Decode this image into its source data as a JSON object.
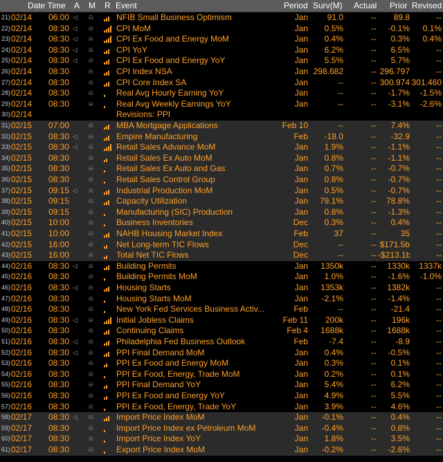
{
  "header": {
    "date_time": "Date Time",
    "a": "A",
    "m": "M",
    "r": "R",
    "event": "Event",
    "period": "Period",
    "surv": "Surv(M)",
    "actual": "Actual",
    "prior": "Prior",
    "revised": "Revised"
  },
  "rows": [
    {
      "num": "21)",
      "date": "02/14",
      "time": "06:00",
      "alarm": true,
      "rel": 3,
      "event": "NFIB Small Business Optimism",
      "period": "Jan",
      "surv": "91.0",
      "actual": "--",
      "prior": "89.8",
      "revised": "--",
      "day": 1
    },
    {
      "num": "22)",
      "date": "02/14",
      "time": "08:30",
      "alarm": true,
      "rel": 4,
      "event": "CPI MoM",
      "period": "Jan",
      "surv": "0.5%",
      "actual": "--",
      "prior": "-0.1%",
      "revised": "0.1%",
      "day": 1
    },
    {
      "num": "23)",
      "date": "02/14",
      "time": "08:30",
      "alarm": true,
      "rel": 4,
      "event": "CPI Ex Food and Energy MoM",
      "period": "Jan",
      "surv": "0.4%",
      "actual": "--",
      "prior": "0.3%",
      "revised": "0.4%",
      "day": 1
    },
    {
      "num": "24)",
      "date": "02/14",
      "time": "08:30",
      "alarm": true,
      "rel": 3,
      "event": "CPI YoY",
      "period": "Jan",
      "surv": "6.2%",
      "actual": "--",
      "prior": "6.5%",
      "revised": "--",
      "day": 1
    },
    {
      "num": "25)",
      "date": "02/14",
      "time": "08:30",
      "alarm": true,
      "rel": 3,
      "event": "CPI Ex Food and Energy YoY",
      "period": "Jan",
      "surv": "5.5%",
      "actual": "--",
      "prior": "5.7%",
      "revised": "--",
      "day": 1
    },
    {
      "num": "26)",
      "date": "02/14",
      "time": "08:30",
      "alarm": false,
      "rel": 3,
      "event": "CPI Index NSA",
      "period": "Jan",
      "surv": "298.682",
      "actual": "--",
      "prior": "296.797",
      "revised": "--",
      "day": 1
    },
    {
      "num": "27)",
      "date": "02/14",
      "time": "08:30",
      "alarm": false,
      "rel": 3,
      "event": "CPI Core Index SA",
      "period": "Jan",
      "surv": "--",
      "actual": "--",
      "prior": "300.974",
      "revised": "301.460",
      "day": 1
    },
    {
      "num": "28)",
      "date": "02/14",
      "time": "08:30",
      "alarm": false,
      "rel": 1,
      "event": "Real Avg Hourly Earning YoY",
      "period": "Jan",
      "surv": "--",
      "actual": "--",
      "prior": "-1.7%",
      "revised": "-1.5%",
      "day": 1
    },
    {
      "num": "29)",
      "date": "02/14",
      "time": "08:30",
      "alarm": false,
      "rel": 1,
      "event": "Real Avg Weekly Earnings YoY",
      "period": "Jan",
      "surv": "--",
      "actual": "--",
      "prior": "-3.1%",
      "revised": "-2.6%",
      "day": 1
    },
    {
      "num": "30)",
      "date": "02/14",
      "time": "",
      "alarm": false,
      "bell": false,
      "rel": 0,
      "event": "Revisions: PPI",
      "period": "",
      "surv": "",
      "actual": "",
      "prior": "",
      "revised": "",
      "day": 1,
      "rev": true
    },
    {
      "num": "31)",
      "date": "02/15",
      "time": "07:00",
      "alarm": false,
      "rel": 3,
      "event": "MBA Mortgage Applications",
      "period": "Feb 10",
      "surv": "--",
      "actual": "--",
      "prior": "7.4%",
      "revised": "--",
      "day": 2
    },
    {
      "num": "32)",
      "date": "02/15",
      "time": "08:30",
      "alarm": true,
      "rel": 3,
      "event": "Empire Manufacturing",
      "period": "Feb",
      "surv": "-18.0",
      "actual": "--",
      "prior": "-32.9",
      "revised": "--",
      "day": 2
    },
    {
      "num": "33)",
      "date": "02/15",
      "time": "08:30",
      "alarm": true,
      "rel": 4,
      "event": "Retail Sales Advance MoM",
      "period": "Jan",
      "surv": "1.9%",
      "actual": "--",
      "prior": "-1.1%",
      "revised": "--",
      "day": 2
    },
    {
      "num": "34)",
      "date": "02/15",
      "time": "08:30",
      "alarm": false,
      "rel": 2,
      "event": "Retail Sales Ex Auto MoM",
      "period": "Jan",
      "surv": "0.8%",
      "actual": "--",
      "prior": "-1.1%",
      "revised": "--",
      "day": 2
    },
    {
      "num": "35)",
      "date": "02/15",
      "time": "08:30",
      "alarm": false,
      "rel": 1,
      "event": "Retail Sales Ex Auto and Gas",
      "period": "Jan",
      "surv": "0.7%",
      "actual": "--",
      "prior": "-0.7%",
      "revised": "--",
      "day": 2
    },
    {
      "num": "36)",
      "date": "02/15",
      "time": "08:30",
      "alarm": false,
      "rel": 1,
      "event": "Retail Sales Control Group",
      "period": "Jan",
      "surv": "0.8%",
      "actual": "--",
      "prior": "-0.7%",
      "revised": "--",
      "day": 2
    },
    {
      "num": "37)",
      "date": "02/15",
      "time": "09:15",
      "alarm": true,
      "rel": 3,
      "event": "Industrial Production MoM",
      "period": "Jan",
      "surv": "0.5%",
      "actual": "--",
      "prior": "-0.7%",
      "revised": "--",
      "day": 2
    },
    {
      "num": "38)",
      "date": "02/15",
      "time": "09:15",
      "alarm": false,
      "rel": 3,
      "event": "Capacity Utilization",
      "period": "Jan",
      "surv": "79.1%",
      "actual": "--",
      "prior": "78.8%",
      "revised": "--",
      "day": 2
    },
    {
      "num": "39)",
      "date": "02/15",
      "time": "09:15",
      "alarm": false,
      "rel": 1,
      "event": "Manufacturing (SIC) Production",
      "period": "Jan",
      "surv": "0.8%",
      "actual": "--",
      "prior": "-1.3%",
      "revised": "--",
      "day": 2
    },
    {
      "num": "40)",
      "date": "02/15",
      "time": "10:00",
      "alarm": false,
      "rel": 1,
      "event": "Business Inventories",
      "period": "Dec",
      "surv": "0.3%",
      "actual": "--",
      "prior": "0.4%",
      "revised": "--",
      "day": 2
    },
    {
      "num": "41)",
      "date": "02/15",
      "time": "10:00",
      "alarm": false,
      "rel": 3,
      "event": "NAHB Housing Market Index",
      "period": "Feb",
      "surv": "37",
      "actual": "--",
      "prior": "35",
      "revised": "--",
      "day": 2
    },
    {
      "num": "42)",
      "date": "02/15",
      "time": "16:00",
      "alarm": false,
      "rel": 2,
      "event": "Net Long-term TIC Flows",
      "period": "Dec",
      "surv": "--",
      "actual": "--",
      "prior": "$171.5b",
      "revised": "--",
      "day": 2
    },
    {
      "num": "43)",
      "date": "02/15",
      "time": "16:00",
      "alarm": false,
      "rel": 2,
      "event": "Total Net TIC Flows",
      "period": "Dec",
      "surv": "--",
      "actual": "--",
      "prior": "-$213.1b",
      "revised": "--",
      "day": 2
    },
    {
      "num": "44)",
      "date": "02/16",
      "time": "08:30",
      "alarm": true,
      "rel": 3,
      "event": "Building Permits",
      "period": "Jan",
      "surv": "1350k",
      "actual": "--",
      "prior": "1330k",
      "revised": "1337k",
      "day": 3
    },
    {
      "num": "45)",
      "date": "02/16",
      "time": "08:30",
      "alarm": false,
      "rel": 1,
      "event": "Building Permits MoM",
      "period": "Jan",
      "surv": "1.0%",
      "actual": "--",
      "prior": "-1.6%",
      "revised": "-1.0%",
      "day": 3
    },
    {
      "num": "46)",
      "date": "02/16",
      "time": "08:30",
      "alarm": true,
      "rel": 3,
      "event": "Housing Starts",
      "period": "Jan",
      "surv": "1353k",
      "actual": "--",
      "prior": "1382k",
      "revised": "--",
      "day": 3
    },
    {
      "num": "47)",
      "date": "02/16",
      "time": "08:30",
      "alarm": false,
      "rel": 1,
      "event": "Housing Starts MoM",
      "period": "Jan",
      "surv": "-2.1%",
      "actual": "--",
      "prior": "-1.4%",
      "revised": "--",
      "day": 3
    },
    {
      "num": "48)",
      "date": "02/16",
      "time": "08:30",
      "alarm": false,
      "rel": 1,
      "event": "New York Fed Services Business Activ...",
      "period": "Feb",
      "surv": "--",
      "actual": "--",
      "prior": "-21.4",
      "revised": "--",
      "day": 3
    },
    {
      "num": "49)",
      "date": "02/16",
      "time": "08:30",
      "alarm": true,
      "rel": 4,
      "event": "Initial Jobless Claims",
      "period": "Feb 11",
      "surv": "200k",
      "actual": "--",
      "prior": "196k",
      "revised": "--",
      "day": 3
    },
    {
      "num": "50)",
      "date": "02/16",
      "time": "08:30",
      "alarm": false,
      "rel": 3,
      "event": "Continuing Claims",
      "period": "Feb 4",
      "surv": "1688k",
      "actual": "--",
      "prior": "1688k",
      "revised": "--",
      "day": 3
    },
    {
      "num": "51)",
      "date": "02/16",
      "time": "08:30",
      "alarm": true,
      "rel": 3,
      "event": "Philadelphia Fed Business Outlook",
      "period": "Feb",
      "surv": "-7.4",
      "actual": "--",
      "prior": "-8.9",
      "revised": "--",
      "day": 3
    },
    {
      "num": "52)",
      "date": "02/16",
      "time": "08:30",
      "alarm": true,
      "rel": 3,
      "event": "PPI Final Demand MoM",
      "period": "Jan",
      "surv": "0.4%",
      "actual": "--",
      "prior": "-0.5%",
      "revised": "--",
      "day": 3
    },
    {
      "num": "53)",
      "date": "02/16",
      "time": "08:30",
      "alarm": false,
      "rel": 2,
      "event": "PPI Ex Food and Energy MoM",
      "period": "Jan",
      "surv": "0.3%",
      "actual": "--",
      "prior": "0.1%",
      "revised": "--",
      "day": 3
    },
    {
      "num": "54)",
      "date": "02/16",
      "time": "08:30",
      "alarm": false,
      "rel": 1,
      "event": "PPI Ex Food, Energy, Trade MoM",
      "period": "Jan",
      "surv": "0.2%",
      "actual": "--",
      "prior": "0.1%",
      "revised": "--",
      "day": 3
    },
    {
      "num": "55)",
      "date": "02/16",
      "time": "08:30",
      "alarm": false,
      "rel": 2,
      "event": "PPI Final Demand YoY",
      "period": "Jan",
      "surv": "5.4%",
      "actual": "--",
      "prior": "6.2%",
      "revised": "--",
      "day": 3
    },
    {
      "num": "56)",
      "date": "02/16",
      "time": "08:30",
      "alarm": false,
      "rel": 2,
      "event": "PPI Ex Food and Energy YoY",
      "period": "Jan",
      "surv": "4.9%",
      "actual": "--",
      "prior": "5.5%",
      "revised": "--",
      "day": 3
    },
    {
      "num": "57)",
      "date": "02/16",
      "time": "08:30",
      "alarm": false,
      "rel": 1,
      "event": "PPI Ex Food, Energy, Trade YoY",
      "period": "Jan",
      "surv": "3.9%",
      "actual": "--",
      "prior": "4.6%",
      "revised": "--",
      "day": 3
    },
    {
      "num": "58)",
      "date": "02/17",
      "time": "08:30",
      "alarm": true,
      "rel": 3,
      "event": "Import Price Index MoM",
      "period": "Jan",
      "surv": "-0.1%",
      "actual": "--",
      "prior": "0.4%",
      "revised": "--",
      "day": 4
    },
    {
      "num": "59)",
      "date": "02/17",
      "time": "08:30",
      "alarm": false,
      "rel": 1,
      "event": "Import Price Index ex Petroleum MoM",
      "period": "Jan",
      "surv": "-0.4%",
      "actual": "--",
      "prior": "0.8%",
      "revised": "--",
      "day": 4
    },
    {
      "num": "60)",
      "date": "02/17",
      "time": "08:30",
      "alarm": false,
      "rel": 1,
      "event": "Import Price Index YoY",
      "period": "Jan",
      "surv": "1.8%",
      "actual": "--",
      "prior": "3.5%",
      "revised": "--",
      "day": 4
    },
    {
      "num": "61)",
      "date": "02/17",
      "time": "08:30",
      "alarm": false,
      "rel": 1,
      "event": "Export Price Index MoM",
      "period": "Jan",
      "surv": "-0.2%",
      "actual": "--",
      "prior": "-2.6%",
      "revised": "--",
      "day": 4
    }
  ],
  "colors": {
    "text": "#ffa028",
    "header_bg": "#5c5c5c",
    "row_bg_a": "#000000",
    "row_bg_b": "#2b2b2b"
  },
  "icons": {
    "alarm": "speaker-icon",
    "bell": "bell-icon",
    "relevance": "relevance-bars-icon"
  }
}
